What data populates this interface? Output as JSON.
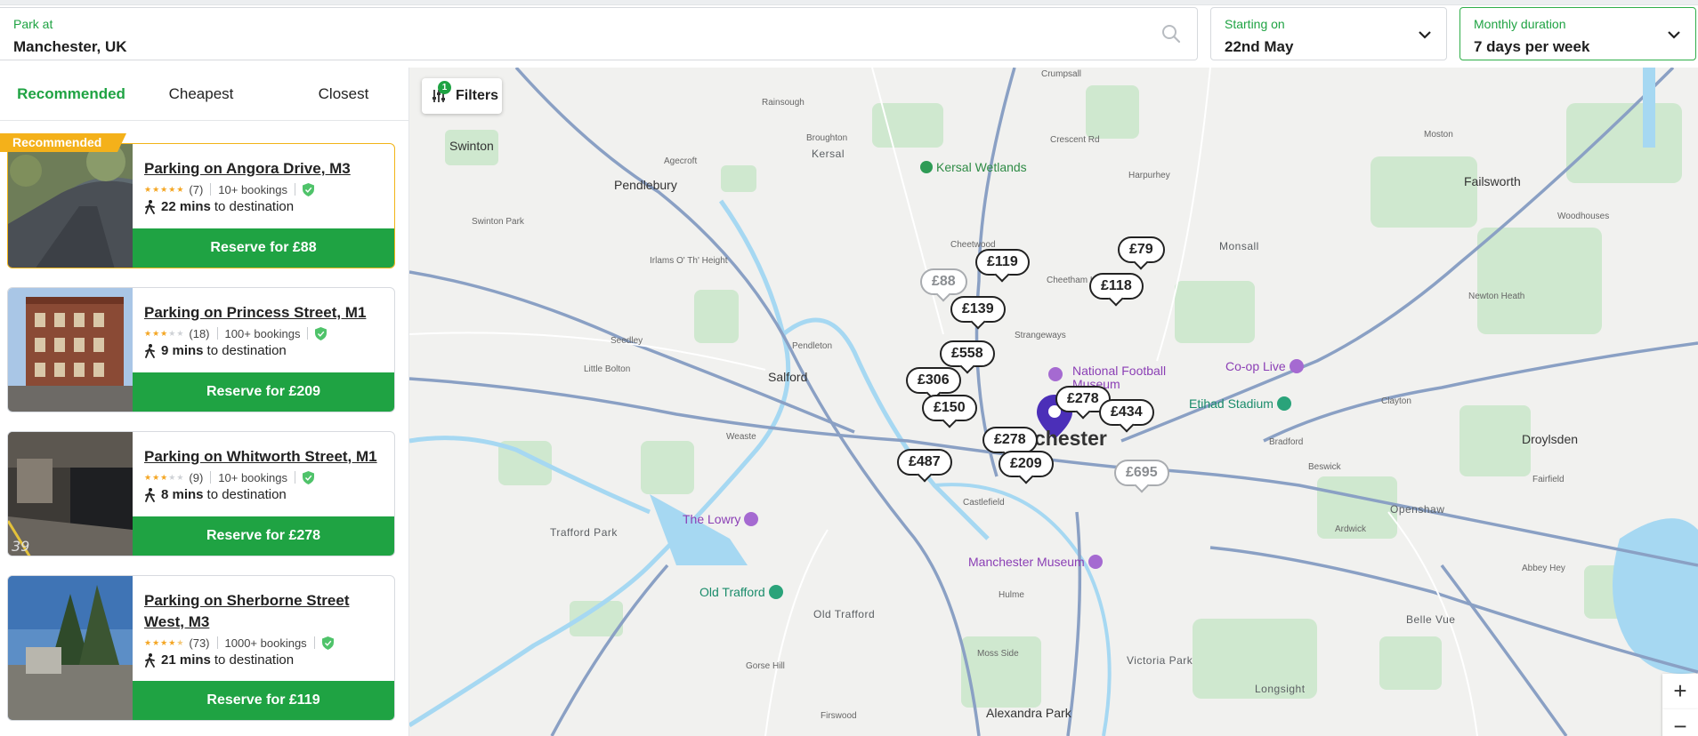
{
  "search": {
    "location_label": "Park at",
    "location_value": "Manchester, UK",
    "start_label": "Starting on",
    "start_value": "22nd May",
    "duration_label": "Monthly duration",
    "duration_value": "7 days per week"
  },
  "tabs": [
    {
      "label": "Recommended",
      "active": true
    },
    {
      "label": "Cheapest",
      "active": false
    },
    {
      "label": "Closest",
      "active": false
    }
  ],
  "recommended_badge": "Recommended",
  "listings": [
    {
      "title": "Parking on Angora Drive, M3",
      "rating": 5,
      "reviews": "(7)",
      "bookings": "10+ bookings",
      "walk_mins": "22 mins",
      "walk_suffix": "to destination",
      "reserve": "Reserve for £88"
    },
    {
      "title": "Parking on Princess Street, M1",
      "rating": 3,
      "reviews": "(18)",
      "bookings": "100+ bookings",
      "walk_mins": "9 mins",
      "walk_suffix": "to destination",
      "reserve": "Reserve for £209"
    },
    {
      "title": "Parking on Whitworth Street, M1",
      "rating": 3,
      "reviews": "(9)",
      "bookings": "10+ bookings",
      "walk_mins": "8 mins",
      "walk_suffix": "to destination",
      "reserve": "Reserve for £278"
    },
    {
      "title": "Parking on Sherborne Street West, M3",
      "rating": 4.5,
      "reviews": "(73)",
      "bookings": "1000+ bookings",
      "walk_mins": "21 mins",
      "walk_suffix": "to destination",
      "reserve": "Reserve for £119"
    }
  ],
  "map": {
    "filters_label": "Filters",
    "filters_count": "1",
    "center_label": "Manchester",
    "zoom_in": "+",
    "zoom_out": "−",
    "price_pins": [
      "£119",
      "£88",
      "£139",
      "£558",
      "£306",
      "£150",
      "£79",
      "£118",
      "£278",
      "£434",
      "£278",
      "£209",
      "£487",
      "£695"
    ],
    "places": [
      "Swinton",
      "Pendlebury",
      "Kersal",
      "Broughton",
      "Agecroft",
      "Rainsough",
      "Crumpsall",
      "Crescent Rd",
      "Harpurhey",
      "Moston",
      "Newton Heath",
      "Failsworth",
      "Woodhouses",
      "Monsall",
      "Cheetham Hill",
      "Cheetwood",
      "Salford",
      "Pendleton",
      "Seedley",
      "Little Bolton",
      "Irlams O' Th' Height",
      "Swinton Park",
      "Weaste",
      "Trafford Park",
      "Old Trafford",
      "Hulme",
      "Moss Side",
      "Ardwick",
      "Openshaw",
      "Droylsden",
      "Fairfield",
      "Clayton",
      "Bradford",
      "Beswick",
      "Belle Vue",
      "Longsight",
      "Victoria Park",
      "Abbey Hey",
      "Gorse Hill",
      "Firswood",
      "Alexandra Park",
      "Strangeways",
      "Castlefield",
      "Kersal Wetlands",
      "The Lowry",
      "Old Trafford",
      "National Football Museum",
      "Manchester Museum",
      "Etihad Stadium",
      "Co-op Live"
    ]
  },
  "colors": {
    "brand_green": "#1fa343",
    "badge_amber": "#f4b11a"
  }
}
